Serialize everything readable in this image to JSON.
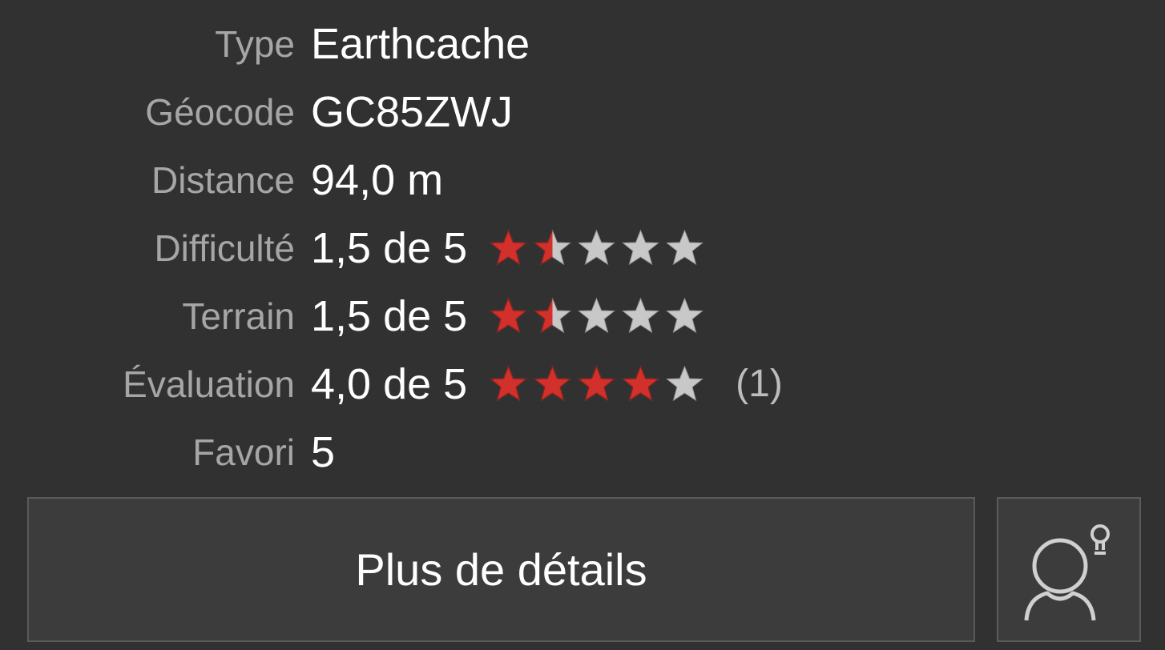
{
  "details": [
    {
      "label": "Type",
      "value": "Earthcache"
    },
    {
      "label": "Géocode",
      "value": "GC85ZWJ"
    },
    {
      "label": "Distance",
      "value": "94,0 m"
    },
    {
      "label": "Difficulté",
      "value": "1,5 de 5",
      "stars": 1.5,
      "max_stars": 5
    },
    {
      "label": "Terrain",
      "value": "1,5 de 5",
      "stars": 1.5,
      "max_stars": 5
    },
    {
      "label": "Évaluation",
      "value": "4,0 de 5",
      "stars": 4.0,
      "max_stars": 5,
      "count": "(1)"
    },
    {
      "label": "Favori",
      "value": "5"
    }
  ],
  "buttons": {
    "more_details": "Plus de détails",
    "hint_icon": "person-lightbulb-icon"
  },
  "colors": {
    "background": "#313131",
    "label": "#a6a6a6",
    "value": "#ffffff",
    "star_filled": "#d2302a",
    "star_empty": "#c8c8c8"
  }
}
